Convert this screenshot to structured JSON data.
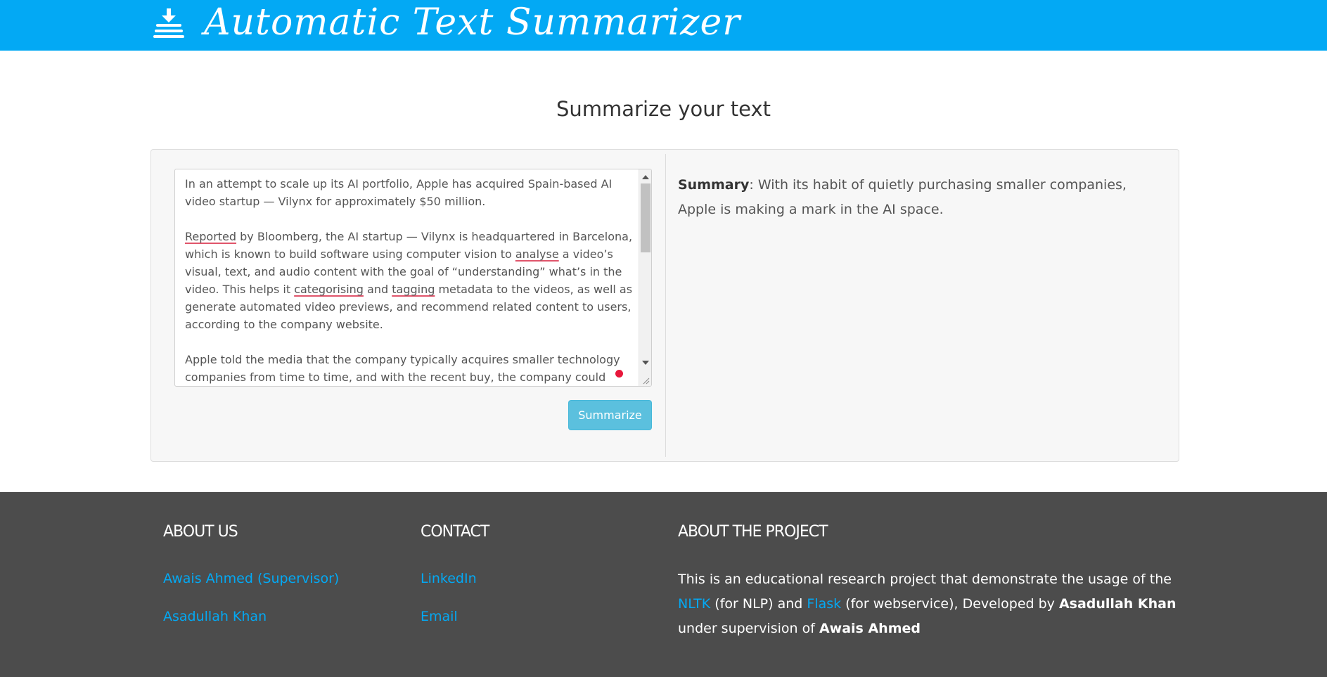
{
  "header": {
    "app_title": "Automatic Text Summarizer",
    "brand_color": "#03a9f4"
  },
  "main": {
    "heading": "Summarize your text",
    "input": {
      "paragraphs": [
        [
          "In an attempt to scale up its AI portfolio, Apple has acquired Spain-based AI video startup — Vilynx for approximately $50 million."
        ],
        [
          "",
          "Reported",
          " by Bloomberg, the AI startup — Vilynx is headquartered in Barcelona, which is known to build software using computer vision to ",
          "analyse",
          " a video’s visual, text, and audio content with the goal of “understanding” what’s in the video. This helps it ",
          "categorising",
          " and ",
          "tagging",
          " metadata to the videos, as well as generate automated video previews, and recommend related content to users, according to the company website."
        ],
        [
          "Apple told the media that the company typically acquires smaller technology companies from time to time, and with the recent buy, the company could"
        ]
      ]
    },
    "summarize_button": "Summarize",
    "summary": {
      "label": "Summary",
      "separator": ": ",
      "text": "With its habit of quietly purchasing smaller companies, Apple is making a mark in the AI space."
    }
  },
  "footer": {
    "about_us": {
      "heading": "ABOUT US",
      "links": [
        "Awais Ahmed (Supervisor)",
        "Asadullah Khan"
      ]
    },
    "contact": {
      "heading": "CONTACT",
      "links": [
        "LinkedIn",
        "Email"
      ]
    },
    "about_project": {
      "heading": "ABOUT THE PROJECT",
      "text_1": "This is an educational research project that demonstrate the usage of the ",
      "link_nltk": "NLTK",
      "text_2": " (for NLP) and ",
      "link_flask": "Flask",
      "text_3": " (for webservice), Developed by ",
      "developer": "Asadullah Khan",
      "text_4": " under supervision of ",
      "supervisor": "Awais Ahmed"
    },
    "background_color": "#4c4c4c",
    "link_color": "#03a9f4"
  }
}
